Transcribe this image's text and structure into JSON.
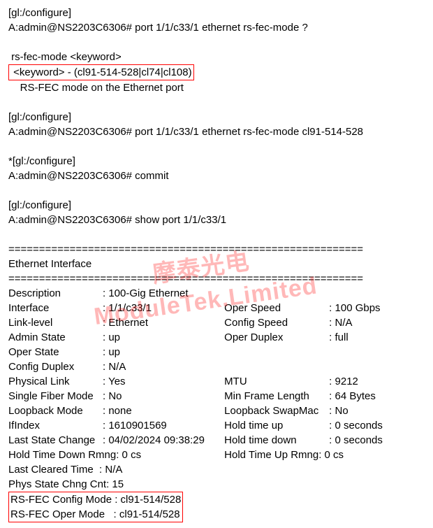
{
  "block1": {
    "context": "[gl:/configure]",
    "prompt": "A:admin@NS2203C6306# port 1/1/c33/1 ethernet rs-fec-mode ?"
  },
  "help": {
    "syntax": " rs-fec-mode <keyword>",
    "options": " <keyword> - (cl91-514-528|cl74|cl108)",
    "desc": "    RS-FEC mode on the Ethernet port"
  },
  "block2": {
    "context": "[gl:/configure]",
    "prompt": "A:admin@NS2203C6306# port 1/1/c33/1 ethernet rs-fec-mode cl91-514-528"
  },
  "block3": {
    "context": "*[gl:/configure]",
    "prompt": "A:admin@NS2203C6306# commit"
  },
  "block4": {
    "context": "[gl:/configure]",
    "prompt": "A:admin@NS2203C6306# show port 1/1/c33/1"
  },
  "sep": "==========================================================",
  "section": "Ethernet Interface",
  "iface": {
    "desc_l": "Description",
    "desc_v": ": 100-Gig Ethernet",
    "intf_l": "Interface",
    "intf_v": ": 1/1/c33/1",
    "linklvl_l": "Link-level",
    "linklvl_v": ": Ethernet",
    "admin_l": "Admin State",
    "admin_v": ": up",
    "operst_l": "Oper State",
    "operst_v": ": up",
    "cfgdup_l": "Config Duplex",
    "cfgdup_v": ": N/A",
    "oper_spd_l": "Oper Speed",
    "oper_spd_v": ": 100 Gbps",
    "cfg_spd_l": "Config Speed",
    "cfg_spd_v": ": N/A",
    "oper_dup_l": "Oper Duplex",
    "oper_dup_v": ": full",
    "phys_l": "Physical Link",
    "phys_v": ": Yes",
    "mtu_l": "MTU",
    "mtu_v": ": 9212",
    "sfm_l": "Single Fiber Mode",
    "sfm_v": ": No",
    "mfl_l": "Min Frame Length",
    "mfl_v": ": 64 Bytes",
    "lbm_l": "Loopback Mode",
    "lbm_v": ": none",
    "lsm_l": "Loopback SwapMac",
    "lsm_v": ": No",
    "ifidx_l": "IfIndex",
    "ifidx_v": ": 1610901569",
    "htu_l": "Hold time up",
    "htu_v": ": 0 seconds",
    "lsc_l": "Last State Change",
    "lsc_v": ": 04/02/2024 09:38:29",
    "htd_l": "Hold time down",
    "htd_v": ": 0 seconds",
    "htdr": "Hold Time Down Rmng: 0 cs",
    "htur": "Hold Time Up Rmng: 0 cs",
    "lct": "Last Cleared Time  : N/A",
    "pscc": "Phys State Chng Cnt: 15"
  },
  "fec": {
    "cfg": "RS-FEC Config Mode : cl91-514/528",
    "oper": "RS-FEC Oper Mode   : cl91-514/528"
  },
  "watermark": "摩泰光电\nModuleTek.Limited"
}
